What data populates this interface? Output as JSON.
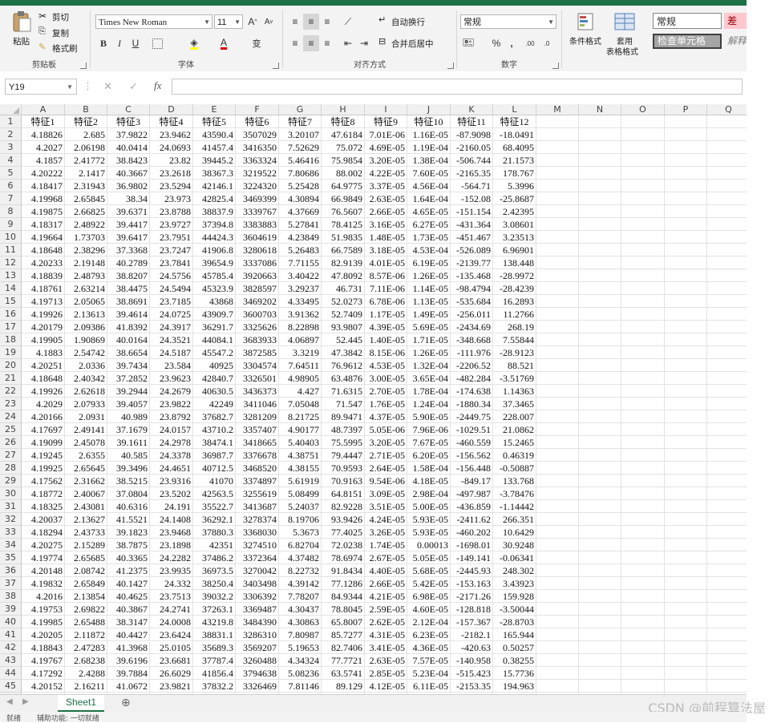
{
  "ribbon": {
    "clipboard": {
      "paste": "粘贴",
      "cut": "剪切",
      "copy": "复制",
      "format_painter": "格式刷",
      "label": "剪贴板"
    },
    "font": {
      "name": "Times New Roman",
      "size": "11",
      "bold": "B",
      "italic": "I",
      "underline": "U",
      "grow": "A",
      "shrink": "A",
      "font_color_glyph": "A",
      "wen": "变",
      "label": "字体"
    },
    "alignment": {
      "wrap": "自动换行",
      "merge": "合并后居中",
      "label": "对齐方式"
    },
    "number": {
      "format": "常规",
      "percent": "%",
      "comma": ",",
      "inc_dec": ".00",
      "dec_dec": ".0",
      "label": "数字"
    },
    "styles": {
      "conditional": "条件格式",
      "table_format_1": "套用",
      "table_format_2": "表格格式",
      "normal": "常规",
      "bad": "差",
      "check_cell": "检查单元格",
      "explanatory": "解释"
    }
  },
  "formula_bar": {
    "name_box": "Y19",
    "fx": "fx",
    "cancel": "✕",
    "enter": "✓"
  },
  "columns": [
    "A",
    "B",
    "C",
    "D",
    "E",
    "F",
    "G",
    "H",
    "I",
    "J",
    "K",
    "L",
    "M",
    "N",
    "O",
    "P",
    "Q"
  ],
  "rows": [
    [
      "特征1",
      "特征2",
      "特征3",
      "特征4",
      "特征5",
      "特征6",
      "特征7",
      "特征8",
      "特征9",
      "特征10",
      "特征11",
      "特征12"
    ],
    [
      "4.18826",
      "2.685",
      "37.9822",
      "23.9462",
      "43590.4",
      "3507029",
      "3.20107",
      "47.6184",
      "7.01E-06",
      "1.16E-05",
      "-87.9098",
      "-18.0491"
    ],
    [
      "4.2027",
      "2.06198",
      "40.0414",
      "24.0693",
      "41457.4",
      "3416350",
      "7.52629",
      "75.072",
      "4.69E-05",
      "1.19E-04",
      "-2160.05",
      "68.4095"
    ],
    [
      "4.1857",
      "2.41772",
      "38.8423",
      "23.82",
      "39445.2",
      "3363324",
      "5.46416",
      "75.9854",
      "3.20E-05",
      "1.38E-04",
      "-506.744",
      "21.1573"
    ],
    [
      "4.20222",
      "2.1417",
      "40.3667",
      "23.2618",
      "38367.3",
      "3219522",
      "7.80686",
      "88.002",
      "4.22E-05",
      "7.60E-05",
      "-2165.35",
      "178.767"
    ],
    [
      "4.18417",
      "2.31943",
      "36.9802",
      "23.5294",
      "42146.1",
      "3224320",
      "5.25428",
      "64.9775",
      "3.37E-05",
      "4.56E-04",
      "-564.71",
      "5.3996"
    ],
    [
      "4.19968",
      "2.65845",
      "38.34",
      "23.973",
      "42825.4",
      "3469399",
      "4.30894",
      "66.9849",
      "2.63E-05",
      "1.64E-04",
      "-152.08",
      "-25.8687"
    ],
    [
      "4.19875",
      "2.66825",
      "39.6371",
      "23.8788",
      "38837.9",
      "3339767",
      "4.37669",
      "76.5607",
      "2.66E-05",
      "4.65E-05",
      "-151.154",
      "2.42395"
    ],
    [
      "4.18317",
      "2.48922",
      "39.4417",
      "23.9727",
      "37394.8",
      "3383883",
      "5.27841",
      "78.4125",
      "3.16E-05",
      "6.27E-05",
      "-431.364",
      "3.08601"
    ],
    [
      "4.19664",
      "1.73703",
      "39.6417",
      "23.7951",
      "44424.3",
      "3604619",
      "4.23849",
      "51.9835",
      "1.48E-05",
      "1.73E-05",
      "-451.467",
      "3.23513"
    ],
    [
      "4.18648",
      "2.38296",
      "37.3368",
      "23.7247",
      "41906.8",
      "3280618",
      "5.26483",
      "66.7589",
      "3.18E-05",
      "4.53E-04",
      "-526.089",
      "6.96901"
    ],
    [
      "4.20233",
      "2.19148",
      "40.2789",
      "23.7841",
      "39654.9",
      "3337086",
      "7.71155",
      "82.9139",
      "4.01E-05",
      "6.19E-05",
      "-2139.77",
      "138.448"
    ],
    [
      "4.18839",
      "2.48793",
      "38.8207",
      "24.5756",
      "45785.4",
      "3920663",
      "3.40422",
      "47.8092",
      "8.57E-06",
      "1.26E-05",
      "-135.468",
      "-28.9972"
    ],
    [
      "4.18761",
      "2.63214",
      "38.4475",
      "24.5494",
      "45323.9",
      "3828597",
      "3.29237",
      "46.731",
      "7.11E-06",
      "1.14E-05",
      "-98.4794",
      "-28.4239"
    ],
    [
      "4.19713",
      "2.05065",
      "38.8691",
      "23.7185",
      "43868",
      "3469202",
      "4.33495",
      "52.0273",
      "6.78E-06",
      "1.13E-05",
      "-535.684",
      "16.2893"
    ],
    [
      "4.19926",
      "2.13613",
      "39.4614",
      "24.0725",
      "43909.7",
      "3600703",
      "3.91362",
      "52.7409",
      "1.17E-05",
      "1.49E-05",
      "-256.011",
      "11.2766"
    ],
    [
      "4.20179",
      "2.09386",
      "41.8392",
      "24.3917",
      "36291.7",
      "3325626",
      "8.22898",
      "93.9807",
      "4.39E-05",
      "5.69E-05",
      "-2434.69",
      "268.19"
    ],
    [
      "4.19905",
      "1.90869",
      "40.0164",
      "24.3521",
      "44084.1",
      "3683933",
      "4.06897",
      "52.445",
      "1.40E-05",
      "1.71E-05",
      "-348.668",
      "7.55844"
    ],
    [
      "4.1883",
      "2.54742",
      "38.6654",
      "24.5187",
      "45547.2",
      "3872585",
      "3.3219",
      "47.3842",
      "8.15E-06",
      "1.26E-05",
      "-111.976",
      "-28.9123"
    ],
    [
      "4.20251",
      "2.0336",
      "39.7434",
      "23.584",
      "40925",
      "3304574",
      "7.64511",
      "76.9612",
      "4.53E-05",
      "1.32E-04",
      "-2206.52",
      "88.521"
    ],
    [
      "4.18648",
      "2.40342",
      "37.2852",
      "23.9623",
      "42840.7",
      "3326501",
      "4.98905",
      "63.4876",
      "3.00E-05",
      "3.65E-04",
      "-482.284",
      "-3.51769"
    ],
    [
      "4.19926",
      "2.62618",
      "39.2944",
      "24.2679",
      "40630.5",
      "3436373",
      "4.427",
      "71.6315",
      "2.70E-05",
      "1.78E-04",
      "-174.638",
      "1.14363"
    ],
    [
      "4.2029",
      "2.07933",
      "39.4057",
      "23.9822",
      "42249",
      "3411046",
      "7.05048",
      "71.547",
      "1.76E-05",
      "1.24E-04",
      "-1880.34",
      "37.3465"
    ],
    [
      "4.20166",
      "2.0931",
      "40.989",
      "23.8792",
      "37682.7",
      "3281209",
      "8.21725",
      "89.9471",
      "4.37E-05",
      "5.90E-05",
      "-2449.75",
      "228.007"
    ],
    [
      "4.17697",
      "2.49141",
      "37.1679",
      "24.0157",
      "43710.2",
      "3357407",
      "4.90177",
      "48.7397",
      "5.05E-06",
      "7.96E-06",
      "-1029.51",
      "21.0862"
    ],
    [
      "4.19099",
      "2.45078",
      "39.1611",
      "24.2978",
      "38474.1",
      "3418665",
      "5.40403",
      "75.5995",
      "3.20E-05",
      "7.67E-05",
      "-460.559",
      "15.2465"
    ],
    [
      "4.19245",
      "2.6355",
      "40.585",
      "24.3378",
      "36987.7",
      "3376678",
      "4.38751",
      "79.4447",
      "2.71E-05",
      "6.20E-05",
      "-156.562",
      "0.46319"
    ],
    [
      "4.19925",
      "2.65645",
      "39.3496",
      "24.4651",
      "40712.5",
      "3468520",
      "4.38155",
      "70.9593",
      "2.64E-05",
      "1.58E-04",
      "-156.448",
      "-0.50887"
    ],
    [
      "4.17562",
      "2.31662",
      "38.5215",
      "23.9316",
      "41070",
      "3374897",
      "5.61919",
      "70.9163",
      "9.54E-06",
      "4.18E-05",
      "-849.17",
      "133.768"
    ],
    [
      "4.18772",
      "2.40067",
      "37.0804",
      "23.5202",
      "42563.5",
      "3255619",
      "5.08499",
      "64.8151",
      "3.09E-05",
      "2.98E-04",
      "-497.987",
      "-3.78476"
    ],
    [
      "4.18325",
      "2.43081",
      "40.6316",
      "24.191",
      "35522.7",
      "3413687",
      "5.24037",
      "82.9228",
      "3.51E-05",
      "5.00E-05",
      "-436.859",
      "-1.14442"
    ],
    [
      "4.20037",
      "2.13627",
      "41.5521",
      "24.1408",
      "36292.1",
      "3278374",
      "8.19706",
      "93.9426",
      "4.24E-05",
      "5.93E-05",
      "-2411.62",
      "266.351"
    ],
    [
      "4.18294",
      "2.43733",
      "39.1823",
      "23.9468",
      "37880.3",
      "3368030",
      "5.3673",
      "77.4025",
      "3.26E-05",
      "5.93E-05",
      "-460.202",
      "10.6429"
    ],
    [
      "4.20275",
      "2.15289",
      "38.7875",
      "23.1898",
      "42351",
      "3274510",
      "6.82704",
      "72.0238",
      "1.74E-05",
      "0.00013",
      "-1698.01",
      "30.9248"
    ],
    [
      "4.19774",
      "2.65685",
      "40.3365",
      "24.2282",
      "37486.2",
      "3372364",
      "4.37482",
      "78.6974",
      "2.67E-05",
      "5.05E-05",
      "-149.141",
      "-0.06341"
    ],
    [
      "4.20148",
      "2.08742",
      "41.2375",
      "23.9935",
      "36973.5",
      "3270042",
      "8.22732",
      "91.8434",
      "4.40E-05",
      "5.68E-05",
      "-2445.93",
      "248.302"
    ],
    [
      "4.19832",
      "2.65849",
      "40.1427",
      "24.332",
      "38250.4",
      "3403498",
      "4.39142",
      "77.1286",
      "2.66E-05",
      "5.42E-05",
      "-153.163",
      "3.43923"
    ],
    [
      "4.2016",
      "2.13854",
      "40.4625",
      "23.7513",
      "39032.2",
      "3306392",
      "7.78207",
      "84.9344",
      "4.21E-05",
      "6.98E-05",
      "-2171.26",
      "159.928"
    ],
    [
      "4.19753",
      "2.69822",
      "40.3867",
      "24.2741",
      "37263.1",
      "3369487",
      "4.30437",
      "78.8045",
      "2.59E-05",
      "4.60E-05",
      "-128.818",
      "-3.50044"
    ],
    [
      "4.19985",
      "2.65488",
      "38.3147",
      "24.0008",
      "43219.8",
      "3484390",
      "4.30863",
      "65.8007",
      "2.62E-05",
      "2.12E-04",
      "-157.367",
      "-28.8703"
    ],
    [
      "4.20205",
      "2.11872",
      "40.4427",
      "23.6424",
      "38831.1",
      "3286310",
      "7.80987",
      "85.7277",
      "4.31E-05",
      "6.23E-05",
      "-2182.1",
      "165.944"
    ],
    [
      "4.18843",
      "2.47283",
      "41.3968",
      "25.0105",
      "35689.3",
      "3569207",
      "5.19653",
      "82.7406",
      "3.41E-05",
      "4.36E-05",
      "-420.63",
      "0.50257"
    ],
    [
      "4.19767",
      "2.68238",
      "39.6196",
      "23.6681",
      "37787.4",
      "3260488",
      "4.34324",
      "77.7721",
      "2.63E-05",
      "7.57E-05",
      "-140.958",
      "0.38255"
    ],
    [
      "4.17292",
      "2.4288",
      "39.7884",
      "26.6029",
      "41856.4",
      "3794638",
      "5.08236",
      "63.5741",
      "2.85E-05",
      "5.23E-04",
      "-515.423",
      "15.7736"
    ],
    [
      "4.20152",
      "2.16211",
      "41.0672",
      "23.9821",
      "37832.2",
      "3326469",
      "7.81146",
      "89.129",
      "4.12E-05",
      "6.11E-05",
      "-2153.35",
      "194.963"
    ]
  ],
  "sheet_tabs": [
    "Sheet1"
  ],
  "add_sheet": "⊕",
  "status": {
    "ready": "就绪",
    "accessibility": "辅助功能: 一切就绪"
  },
  "watermark": "CSDN @前程算法屋",
  "colors": {
    "excel_green": "#1e7145",
    "bad_bg": "#ffc7ce",
    "bad_text": "#9c0006",
    "check_bg": "#a5a5a5"
  }
}
